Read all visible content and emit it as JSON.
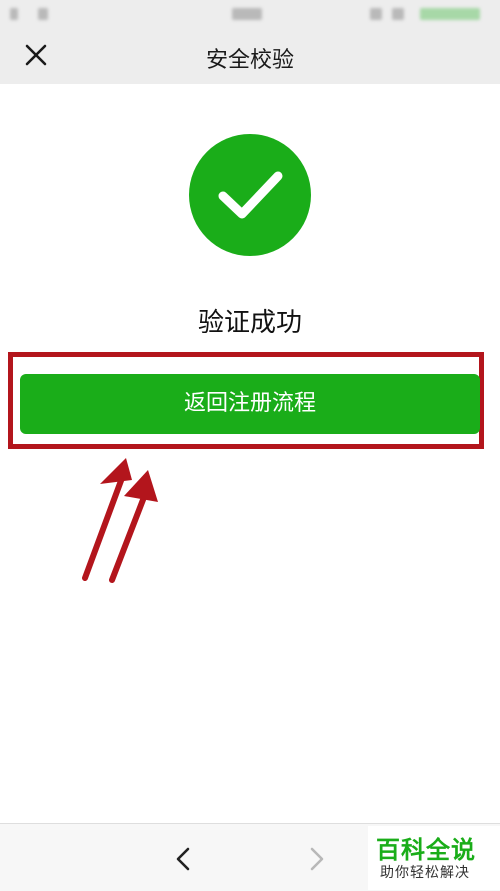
{
  "nav": {
    "title": "安全校验",
    "close_icon": "close-icon"
  },
  "result": {
    "text": "验证成功",
    "icon": "check-circle-icon",
    "icon_color": "#1aad19"
  },
  "action": {
    "return_label": "返回注册流程",
    "button_color": "#1aad19"
  },
  "annotation": {
    "box_color": "#b3151c",
    "arrow_color": "#b3151c"
  },
  "bottom_nav": {
    "back_icon": "chevron-left-icon",
    "forward_icon": "chevron-right-icon"
  },
  "watermark": {
    "title": "百科全说",
    "subtitle": "助你轻松解决"
  }
}
